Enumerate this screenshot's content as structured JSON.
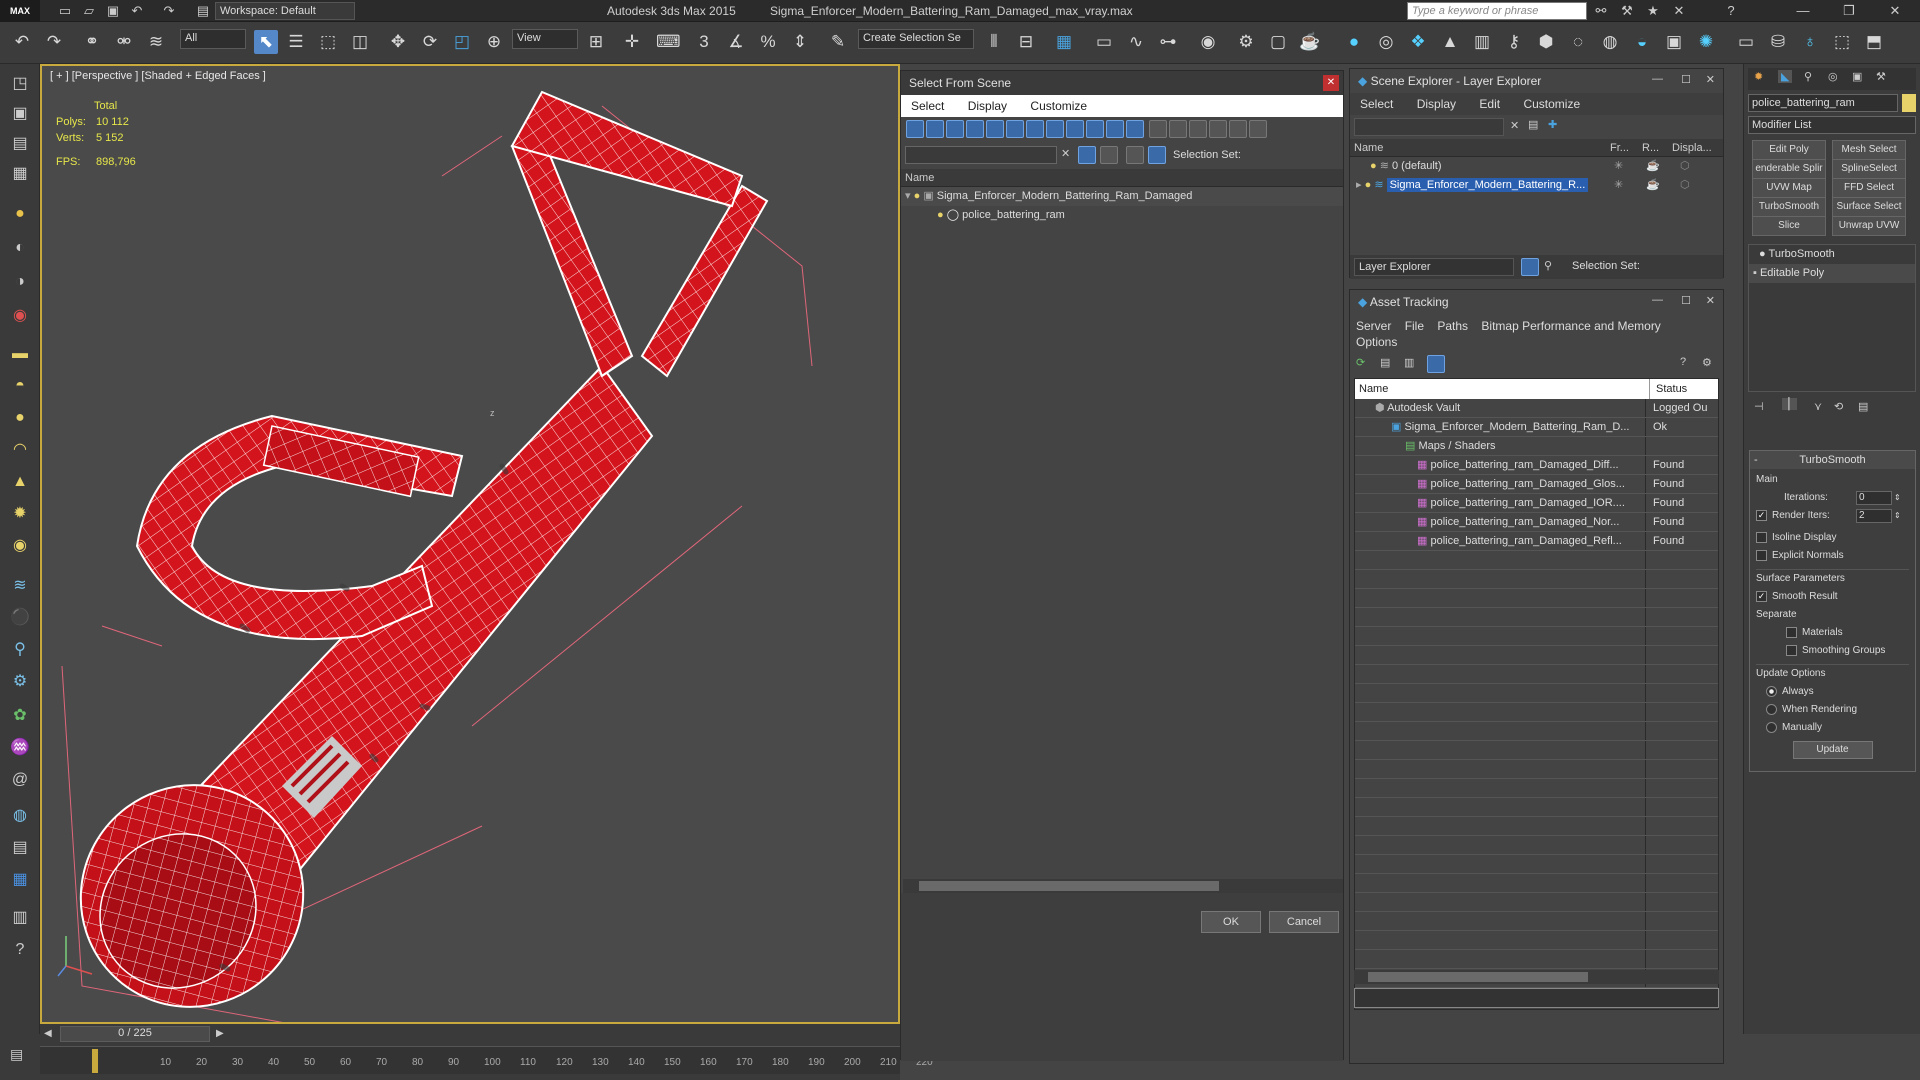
{
  "app": {
    "title": "Autodesk 3ds Max  2015",
    "file": "Sigma_Enforcer_Modern_Battering_Ram_Damaged_max_vray.max",
    "logo": "MAX",
    "workspace": "Workspace: Default",
    "search_placeholder": "Type a keyword or phrase"
  },
  "toolbar": {
    "filter": "All",
    "view": "View",
    "selection_set": "Create Selection Se"
  },
  "viewport": {
    "label": "[ + ] [Perspective ] [Shaded + Edged Faces ]",
    "total_label": "Total",
    "polys_label": "Polys:",
    "polys": "10 112",
    "verts_label": "Verts:",
    "verts": "5 152",
    "fps_label": "FPS:",
    "fps": "898,796",
    "axis_z": "z"
  },
  "timeline": {
    "frame": "0 / 225",
    "ticks": [
      "10",
      "20",
      "30",
      "40",
      "50",
      "60",
      "70",
      "80",
      "90",
      "100",
      "110",
      "120",
      "130",
      "140",
      "150",
      "160",
      "170",
      "180",
      "190",
      "200",
      "210",
      "220"
    ]
  },
  "select_from_scene": {
    "title": "Select From Scene",
    "menu": [
      "Select",
      "Display",
      "Customize"
    ],
    "selection_set": "Selection Set:",
    "col_name": "Name",
    "items": [
      "Sigma_Enforcer_Modern_Battering_Ram_Damaged",
      "police_battering_ram"
    ],
    "ok": "OK",
    "cancel": "Cancel"
  },
  "scene_explorer": {
    "title": "Scene Explorer - Layer Explorer",
    "menu": [
      "Select",
      "Display",
      "Edit",
      "Customize"
    ],
    "cols": [
      "Name",
      "Fr...",
      "R...",
      "Displa..."
    ],
    "rows": [
      "0 (default)",
      "Sigma_Enforcer_Modern_Battering_R..."
    ],
    "footer_dd": "Layer Explorer",
    "selection_set": "Selection Set:"
  },
  "asset_tracking": {
    "title": "Asset Tracking",
    "menu": [
      "Server",
      "File",
      "Paths",
      "Bitmap Performance and Memory",
      "Options"
    ],
    "cols": [
      "Name",
      "Status"
    ],
    "rows": [
      {
        "name": "Autodesk Vault",
        "status": "Logged Ou"
      },
      {
        "name": "Sigma_Enforcer_Modern_Battering_Ram_D...",
        "status": "Ok"
      },
      {
        "name": "Maps / Shaders",
        "status": ""
      },
      {
        "name": "police_battering_ram_Damaged_Diff...",
        "status": "Found"
      },
      {
        "name": "police_battering_ram_Damaged_Glos...",
        "status": "Found"
      },
      {
        "name": "police_battering_ram_Damaged_IOR....",
        "status": "Found"
      },
      {
        "name": "police_battering_ram_Damaged_Nor...",
        "status": "Found"
      },
      {
        "name": "police_battering_ram_Damaged_Refl...",
        "status": "Found"
      }
    ]
  },
  "cmd_panel": {
    "object_name": "police_battering_ram",
    "modifier_list": "Modifier List",
    "mod_buttons": [
      "Edit Poly",
      "Mesh Select",
      "enderable Splir",
      "SplineSelect",
      "UVW Map",
      "FFD Select",
      "TurboSmooth",
      "Surface Select",
      "Slice",
      "Unwrap UVW"
    ],
    "stack": [
      "TurboSmooth",
      "Editable Poly"
    ],
    "rollout_title": "TurboSmooth",
    "main": "Main",
    "iterations_label": "Iterations:",
    "iterations": "0",
    "render_iters_label": "Render Iters:",
    "render_iters": "2",
    "isoline": "Isoline Display",
    "explicit": "Explicit Normals",
    "surface_params": "Surface Parameters",
    "smooth_result": "Smooth Result",
    "separate": "Separate",
    "materials": "Materials",
    "smoothing_groups": "Smoothing Groups",
    "update_options": "Update Options",
    "always": "Always",
    "when_rendering": "When Rendering",
    "manually": "Manually",
    "update": "Update"
  },
  "colors": {
    "accent": "#5588c8",
    "viewport_border": "#c8a93e",
    "model_red": "#d4141c",
    "selected_row": "#2a5fb0"
  }
}
